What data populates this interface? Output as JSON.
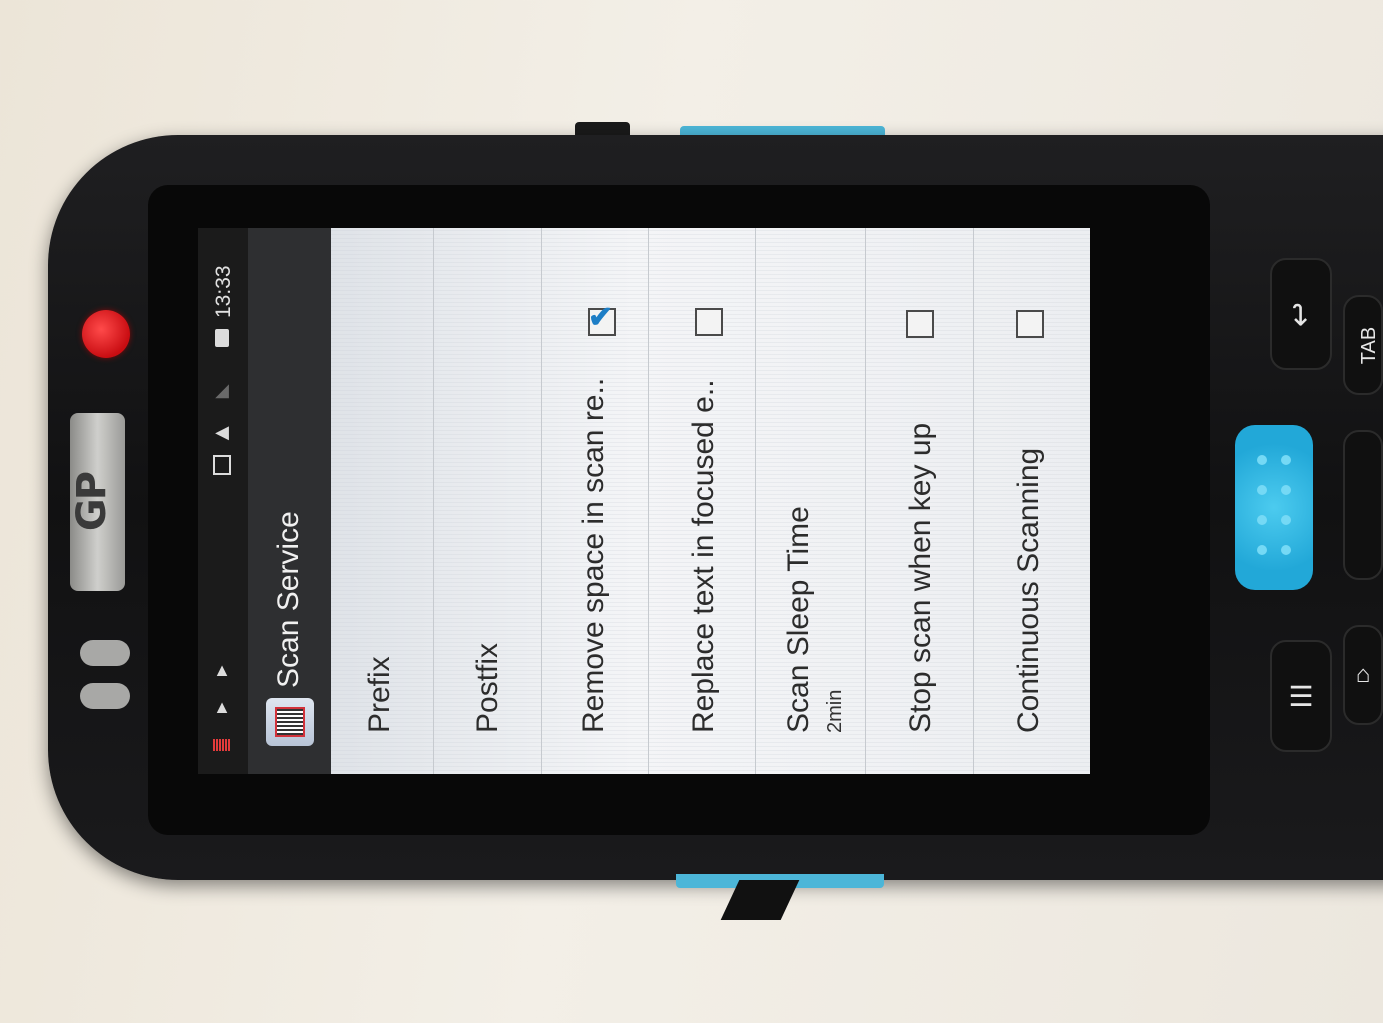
{
  "status_bar": {
    "time": "13:33",
    "icons": [
      "barcode-notification-icon",
      "warning-icon",
      "warning-icon",
      "sim-card-icon",
      "wifi-icon",
      "no-signal-icon",
      "battery-icon"
    ]
  },
  "action_bar": {
    "title": "Scan Service",
    "app_icon": "scan-service-app-icon"
  },
  "settings": [
    {
      "label": "Prefix"
    },
    {
      "label": "Postfix"
    },
    {
      "label": "Remove space in scan re..",
      "checked": true
    },
    {
      "label": "Replace text in focused e..",
      "checked": false
    },
    {
      "label": "Scan Sleep Time",
      "summary": "2min"
    },
    {
      "label": "Stop scan when key up",
      "checked": false
    },
    {
      "label": "Continuous Scanning",
      "checked": false
    }
  ],
  "device": {
    "brand": "GP",
    "accent_color": "#22a8d8",
    "led_color": "#d7141b",
    "keys": [
      "back-icon",
      "tab-key",
      "menu-icon",
      "home-icon"
    ],
    "tab_key_label": "TAB"
  }
}
